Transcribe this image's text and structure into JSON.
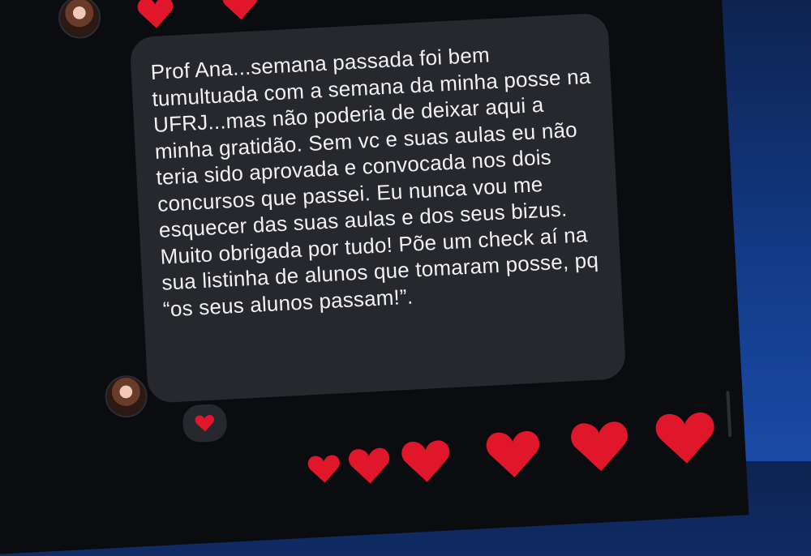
{
  "message": {
    "text": "Prof Ana...semana passada foi bem tumultuada com a semana da minha posse na UFRJ...mas não poderia de deixar aqui a minha gratidão. Sem vc e suas aulas eu não teria sido aprovada e convocada nos dois concursos que passei. Eu nunca vou me esquecer das suas aulas e dos seus bizus. Muito obrigada por tudo! Põe um check aí na sua listinha de alunos que tomaram posse, pq “os seus alunos passam!”."
  },
  "reaction": {
    "icon": "heart-icon",
    "color": "#e0162b"
  },
  "colors": {
    "background": "#123a86",
    "chat": "#0b0c0f",
    "bubble": "#26282d",
    "heart": "#e0162b"
  }
}
